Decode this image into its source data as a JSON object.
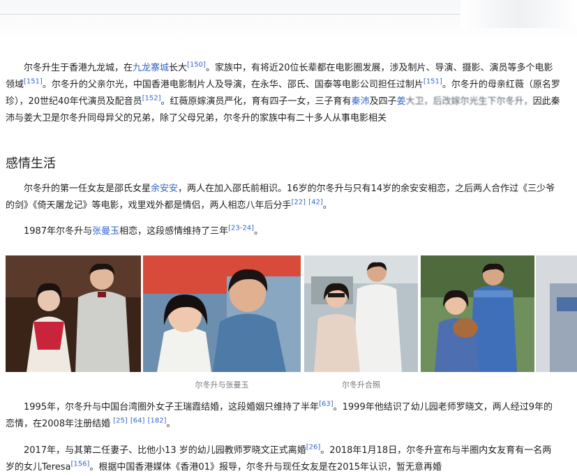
{
  "intro": {
    "l1a": "尔冬升生于香港九龙城，在",
    "l1link": "九龙寨城",
    "l1b": "长大",
    "c150": "[150]",
    "l1c": "。家族中，有将近20位长辈都在电影圈发展，涉及制片、导演、摄影、演员",
    "l2a": "等多个电影领域",
    "c151a": "[151]",
    "l2b": "。尔冬升的父亲尔光，中国香港电影制片人及导演，在永华、邵氏、国泰等电影公司担任过制片",
    "c151b": "[151]",
    "l2c": "。尔",
    "l3a": "冬升的母亲红薇（原名罗珍），20世纪40年代演员及配音员",
    "c152": "[152]",
    "l3b": "。红薇原嫁演员严化，育有四子一女，三子育有",
    "l3link1": "秦沛",
    "l3c": "及四子",
    "l3link2": "姜",
    "l4blur": "大卫，后改嫁尔光生下尔冬升，",
    "l4b": "因此秦沛与姜大卫是尔冬升同母异父的兄弟，除了父母兄弟，尔冬升的家族中有二十多人从事电影相关"
  },
  "section_title": "感情生活",
  "love": {
    "l1a": "尔冬升的第一任女友是邵氏女星",
    "l1link": "余安安",
    "l1b": "，两人在加入邵氏前相识。16岁的尔冬升与只有14岁的余安安相恋，之后两人合作过",
    "l2a": "《三少爷的剑》《倚天屠龙记》等电影，戏里戏外都是情侣，两人相恋八年后分手",
    "c22": "[22]",
    "c42": "[42]",
    "l2b": "。"
  },
  "p1987": {
    "a": "1987年尔冬升与",
    "link": "张曼玉",
    "b": "相恋，这段感情维持了三年",
    "cite": "[23-24]",
    "c": "。"
  },
  "captions": {
    "c1": "尔冬升与张曼玉",
    "c2": "尔冬升合照"
  },
  "p1995": {
    "l1a": "1995年，尔冬升与中国台湾圈外女子王瑞霞结婚，这段婚姻只维持了半年",
    "c63": "[63]",
    "l1b": "。1999年他结识了幼儿园老师罗晓文，两人",
    "l2a": "经过9年的恋情，在2008年注册结婚",
    "c25": "[25]",
    "c64": "[64]",
    "c182": "[182]",
    "l2b": "。"
  },
  "p2017": {
    "l1a": "2017年，与其第二任妻子、比他小13 岁的幼儿园教师罗晓文正式离婚",
    "c26": "[26]",
    "l1b": "。2018年1月18日，尔冬升宣布与半圈内女友育",
    "l2a": "有一名两岁的女儿Teresa",
    "c156": "[156]",
    "l2b": "。根据中国香港媒体《香港01》报导，尔冬升与现任女友是在2015年认识，暂无意再婚"
  },
  "colors": {
    "link": "#3366cc",
    "text": "#202122",
    "caption": "#72777d"
  }
}
